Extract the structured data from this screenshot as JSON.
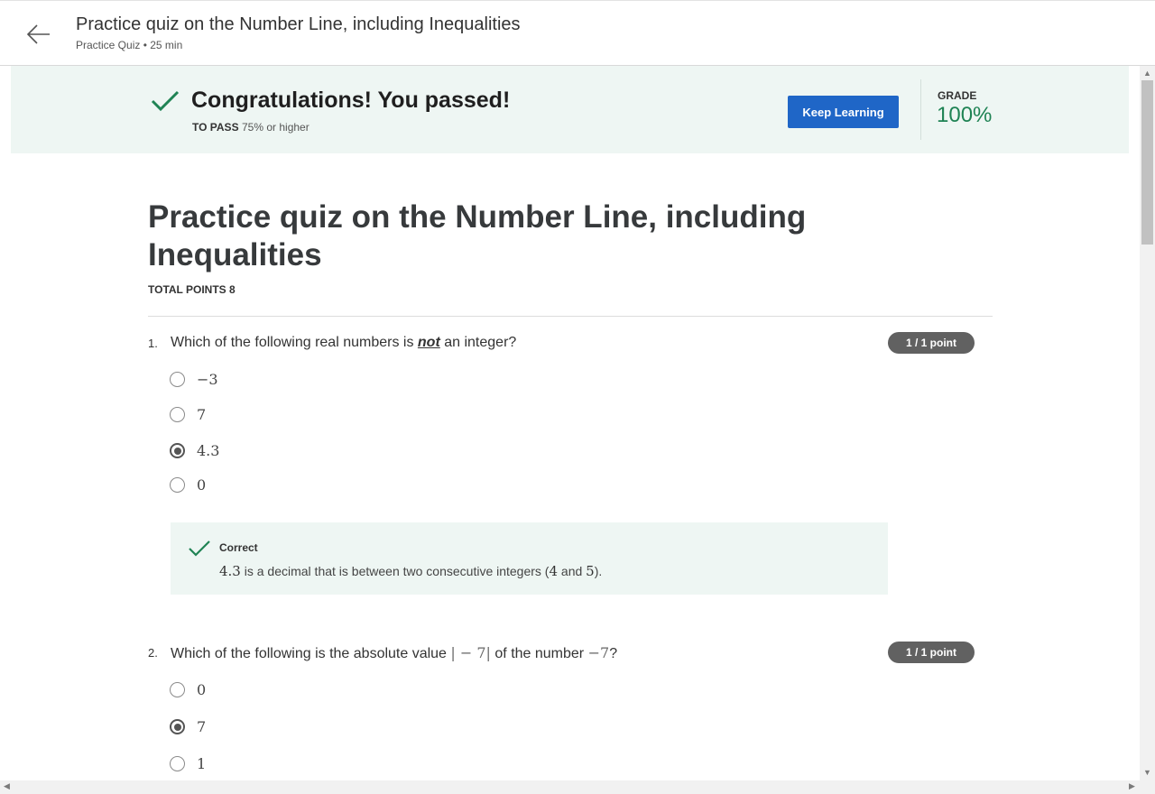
{
  "header": {
    "title": "Practice quiz on the Number Line, including Inequalities",
    "subtitle": "Practice Quiz • 25 min"
  },
  "banner": {
    "title": "Congratulations! You passed!",
    "pass_label": "TO PASS",
    "pass_value": "75% or higher",
    "keep_learning": "Keep Learning",
    "grade_label": "GRADE",
    "grade_value": "100%"
  },
  "quiz": {
    "title": "Practice quiz on the Number Line, including Inequalities",
    "total_points": "TOTAL POINTS 8",
    "questions": [
      {
        "number": "1.",
        "text_before": "Which of the following real numbers is",
        "text_emph": "not",
        "text_after": "an integer?",
        "points": "1 / 1 point",
        "options": [
          "−3",
          "7",
          "4.3",
          "0"
        ],
        "selected": 2,
        "feedback": {
          "status": "Correct",
          "math1": "4.3",
          "text1": "is a decimal that is between two consecutive integers (",
          "math2": "4",
          "text2": "and",
          "math3": "5",
          "text3": ")."
        }
      },
      {
        "number": "2.",
        "text_before": "Which of the following is the absolute value",
        "math1": "| − 7|",
        "text_mid": "of the number",
        "math2": "−7",
        "text_after": "?",
        "points": "1 / 1 point",
        "options": [
          "0",
          "7",
          "1"
        ],
        "selected": 1
      }
    ]
  },
  "colors": {
    "accent_blue": "#1f66c7",
    "success_green": "#1f8354",
    "banner_bg": "#eef6f3",
    "badge_gray": "#616161"
  }
}
